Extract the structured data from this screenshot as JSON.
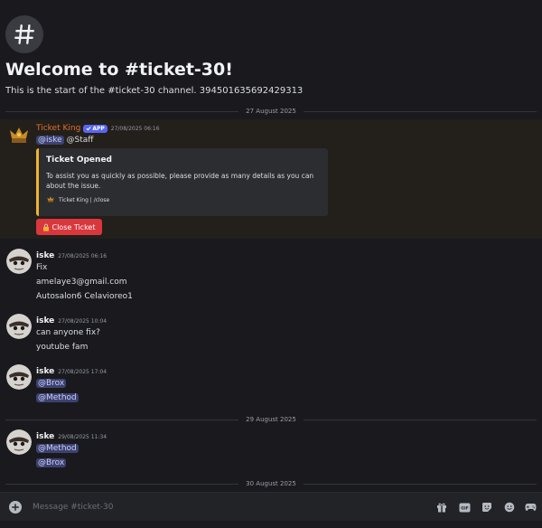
{
  "channel": {
    "welcome_title": "Welcome to #ticket-30!",
    "welcome_subtitle": "This is the start of the #ticket-30 channel. 394501635692429313"
  },
  "dividers": [
    "27 August 2025",
    "29 August 2025",
    "30 August 2025"
  ],
  "bot_message": {
    "author": "Ticket King",
    "badge": "APP",
    "timestamp": "27/08/2025 06:16",
    "mentions": [
      "@iske",
      "@Staff"
    ],
    "embed": {
      "title": "Ticket Opened",
      "description": "To assist you as quickly as possible, please provide as many details as you can about the issue.",
      "footer": "Ticket King | /close"
    },
    "button_label": "Close Ticket"
  },
  "messages": [
    {
      "author": "iske",
      "timestamp": "27/08/2025 06:16",
      "lines": [
        "Fix",
        "amelaye3@gmail.com",
        "Autosalon6 Celavioreo1"
      ]
    },
    {
      "author": "iske",
      "timestamp": "27/08/2025 10:04",
      "lines": [
        "can anyone fix?",
        "youtube fam"
      ]
    },
    {
      "author": "iske",
      "timestamp": "27/08/2025 17:04",
      "lines": [
        "@Brox",
        "@Method"
      ]
    },
    {
      "author": "iske",
      "timestamp": "29/08/2025 11:34",
      "lines": [
        "@Method",
        "@Brox"
      ]
    }
  ],
  "composer": {
    "placeholder": "Message #ticket-30"
  },
  "colors": {
    "background": "#1a1a1e",
    "bot_name": "#e0712f",
    "embed_accent": "#f0b232",
    "danger_button": "#da373c",
    "mention_bg": "#3c4270",
    "app_badge": "#5865f2"
  },
  "icons": [
    "hash-icon",
    "verified-check-icon",
    "lock-icon",
    "add-attachment-icon",
    "gift-icon",
    "gif-icon",
    "sticker-icon",
    "emoji-icon",
    "apps-icon"
  ]
}
